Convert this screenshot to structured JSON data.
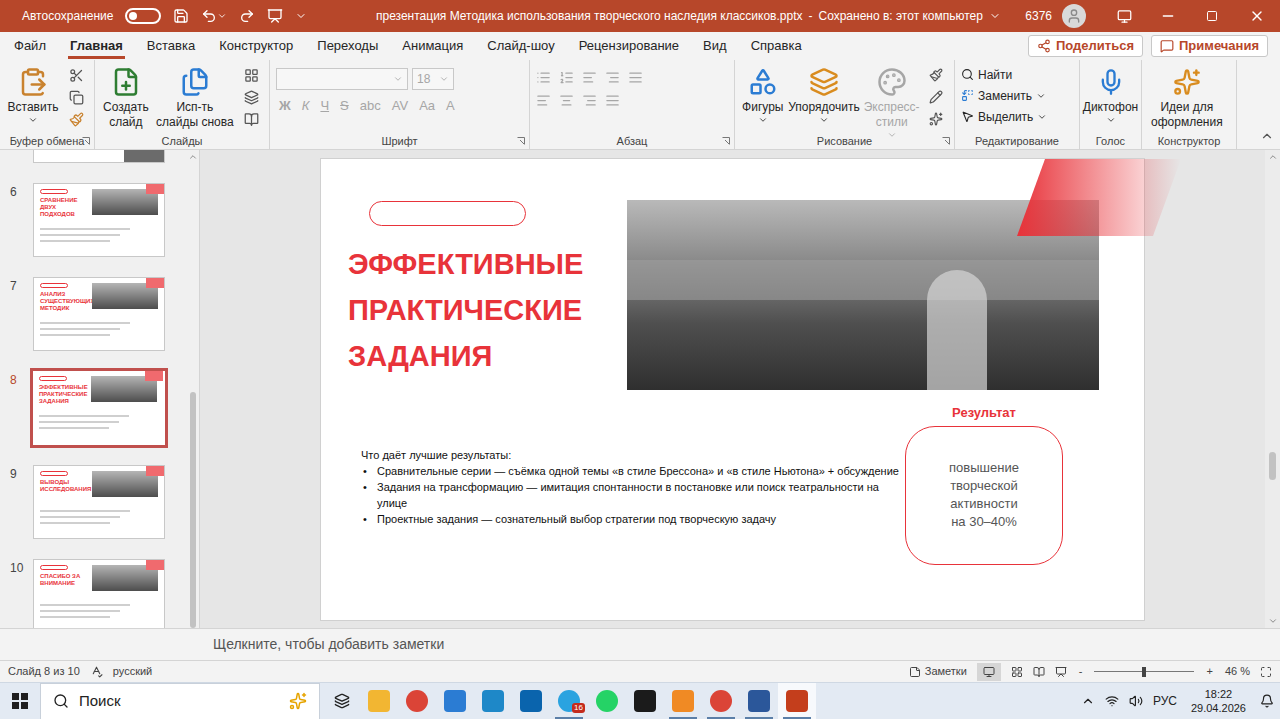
{
  "title_bar": {
    "autosave_label": "Автосохранение",
    "autosave_on": false,
    "document": "презентация Методика использования творческого наследия классиков.pptx",
    "separator": "-",
    "save_status": "Сохранено в: этот компьютер",
    "account_code": "6376"
  },
  "ribbon_tabs": [
    {
      "label": "Файл",
      "selected": false
    },
    {
      "label": "Главная",
      "selected": true
    },
    {
      "label": "Вставка",
      "selected": false
    },
    {
      "label": "Конструктор",
      "selected": false
    },
    {
      "label": "Переходы",
      "selected": false
    },
    {
      "label": "Анимация",
      "selected": false
    },
    {
      "label": "Слайд-шоу",
      "selected": false
    },
    {
      "label": "Рецензирование",
      "selected": false
    },
    {
      "label": "Вид",
      "selected": false
    },
    {
      "label": "Справка",
      "selected": false
    }
  ],
  "share_button": "Поделиться",
  "comments_button": "Примечания",
  "ribbon": {
    "clipboard": {
      "label": "Буфер обмена",
      "paste": "Вставить"
    },
    "slides": {
      "label": "Слайды",
      "new_slide": [
        "Создать",
        "слайд"
      ],
      "reuse": [
        "Исп-ть",
        "слайды снова"
      ]
    },
    "font": {
      "label": "Шрифт",
      "disabled": true,
      "font_name": "",
      "font_size": "18",
      "buttons": [
        "Ж",
        "К",
        "Ч",
        "S",
        "abc",
        "AV",
        "Aa",
        "A"
      ]
    },
    "paragraph": {
      "label": "Абзац",
      "disabled": true
    },
    "drawing": {
      "label": "Рисование",
      "buttons": [
        {
          "label": [
            "Фигуры"
          ],
          "disabled": false
        },
        {
          "label": [
            "Упорядочить"
          ],
          "disabled": false
        },
        {
          "label": [
            "Экспресс-",
            "стили"
          ],
          "disabled": true
        }
      ]
    },
    "editing": {
      "label": "Редактирование",
      "buttons": [
        "Найти",
        "Заменить",
        "Выделить"
      ]
    },
    "voice": {
      "label": "Голос",
      "button": [
        "Диктофон"
      ]
    },
    "designer": {
      "label": "Конструктор",
      "button": [
        "Идеи для",
        "оформления"
      ]
    }
  },
  "thumbnails": [
    {
      "number": "6",
      "title": "СРАВНЕНИЕ ДВУХ ПОДХОДОВ",
      "selected": false
    },
    {
      "number": "7",
      "title": "АНАЛИЗ СУЩЕСТВУЮЩИХ МЕТОДИК",
      "selected": false
    },
    {
      "number": "8",
      "title": "ЭФФЕКТИВНЫЕ ПРАКТИЧЕСКИЕ ЗАДАНИЯ",
      "selected": true
    },
    {
      "number": "9",
      "title": "ВЫВОДЫ ИССЛЕДОВАНИЯ",
      "selected": false
    },
    {
      "number": "10",
      "title": "СПАСИБО ЗА ВНИМАНИЕ",
      "selected": false
    }
  ],
  "slide": {
    "heading": [
      "ЭФФЕКТИВНЫЕ",
      "ПРАКТИЧЕСКИЕ",
      "ЗАДАНИЯ"
    ],
    "result_label": "Результат",
    "result_text": [
      "повышение",
      "творческой",
      "активности",
      "на 30–40%"
    ],
    "intro": "Что даёт лучшие результаты:",
    "bullet_glyph": "•",
    "bullets": [
      "Сравнительные серии — съёмка одной темы «в стиле Брессона» и «в стиле Ньютона» + обсуждение",
      "Задания на трансформацию — имитация спонтанности в постановке или поиск театральности на улице",
      "Проектные задания — сознательный выбор стратегии под творческую задачу"
    ]
  },
  "notes": {
    "placeholder": "Щелкните, чтобы добавить заметки"
  },
  "status_bar": {
    "slide_info": "Слайд 8 из 10",
    "language": "русский",
    "notes_button": "Заметки",
    "zoom_minus": "-",
    "zoom_plus": "+",
    "zoom": "46 %",
    "zoom_level": 0.5
  },
  "taskbar": {
    "search": "Поиск",
    "language": "РУС",
    "time": "18:22",
    "date": "29.04.2026",
    "apps": [
      {
        "kind": "square",
        "color": "#f2b632",
        "running": false,
        "badge": ""
      },
      {
        "kind": "round",
        "color": "#db4437",
        "running": false,
        "badge": ""
      },
      {
        "kind": "square",
        "color": "#2b7cd3",
        "running": false,
        "badge": ""
      },
      {
        "kind": "square",
        "color": "#1e88c8",
        "running": false,
        "badge": ""
      },
      {
        "kind": "square",
        "color": "#0a64ad",
        "running": false,
        "badge": ""
      },
      {
        "kind": "round",
        "color": "#2aa3e0",
        "running": true,
        "badge": "16"
      },
      {
        "kind": "round",
        "color": "#25d366",
        "running": false,
        "badge": ""
      },
      {
        "kind": "square",
        "color": "#1b1b1b",
        "running": false,
        "badge": ""
      },
      {
        "kind": "square",
        "color": "#f08a24",
        "running": true,
        "badge": ""
      },
      {
        "kind": "round",
        "color": "#db4437",
        "running": true,
        "badge": ""
      },
      {
        "kind": "square",
        "color": "#2b579a",
        "running": true,
        "badge": ""
      },
      {
        "kind": "square",
        "color": "#c43e1c",
        "running": true,
        "badge": ""
      }
    ]
  }
}
